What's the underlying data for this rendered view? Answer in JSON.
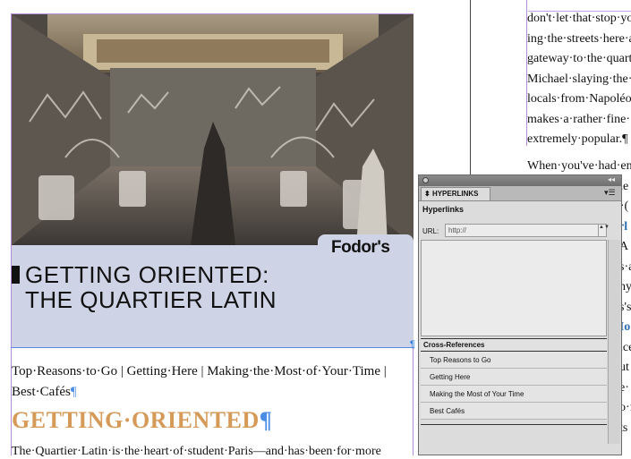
{
  "left_page": {
    "brand_logo": "Fodor's",
    "banner_title_line1": "GETTING ORIENTED:",
    "banner_title_line2": "THE QUARTIER LATIN",
    "reasons_line": "Top·Reasons·to·Go | Getting·Here | Making·the·Most·of·Your·Time | Best·Cafés",
    "section_heading": "GETTING·ORIENTED",
    "body_text": "The·Quartier·Latin·is·the·heart·of·student·Paris—and·has·been·for·more",
    "pilcrow": "¶",
    "frame_port_glyph": "¶"
  },
  "right_column": {
    "lines_top": [
      "don't·let·that·stop·yo",
      "ing·the·streets·here·a",
      "gateway·to·the·quart",
      "Michael·slaying·the·",
      "locals·from·Napoléo",
      "makes·a·rather·fine·",
      "extremely·popular.¶"
    ],
    "lines_bottom": [
      "When·you've·had·en",
      "he",
      "i·(",
      "orl",
      "A",
      "s·a",
      "ny",
      "s's",
      "",
      "Mo",
      "ice",
      "ut",
      "e·",
      "o·f",
      "ts"
    ]
  },
  "hyperlinks_panel": {
    "tab_label": "HYPERLINKS",
    "section_label": "Hyperlinks",
    "url_label": "URL:",
    "url_value": "http://",
    "xref_header": "Cross-References",
    "xrefs": [
      "Top Reasons to Go",
      "Getting Here",
      "Making the Most of Your Time",
      "Best Cafés"
    ],
    "collapse_glyph": "◂◂",
    "menu_glyph": "▾☰",
    "stepper_glyph": "▲▼"
  },
  "colors": {
    "frame_purple": "#b48cd8",
    "banner_bg": "#cfd3e6",
    "heading_orange": "#d59a58",
    "pilcrow_blue": "#4b8ee8",
    "panel_gray": "#dcdcdc"
  }
}
